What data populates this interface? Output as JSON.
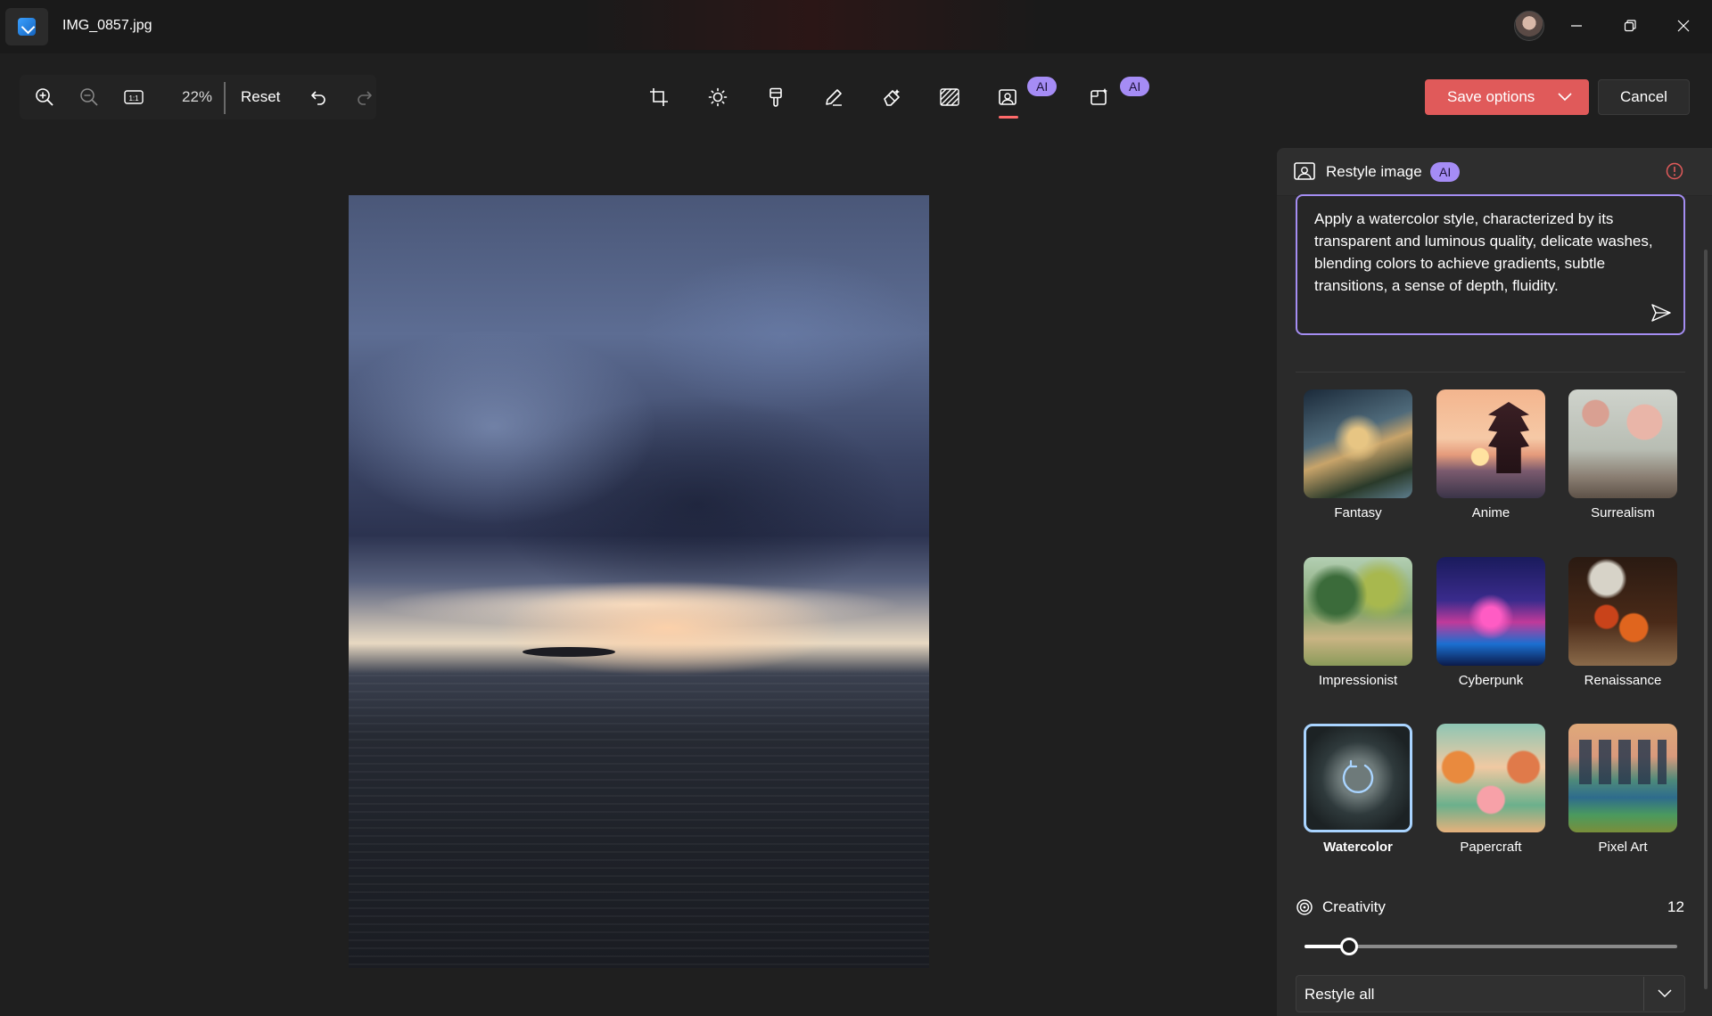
{
  "window": {
    "file_name": "IMG_0857.jpg",
    "controls": [
      "minimize-icon",
      "restore-icon",
      "close-icon"
    ]
  },
  "toolbar": {
    "zoom_level": "22%",
    "reset_label": "Reset",
    "icons": [
      "zoom-in-icon",
      "zoom-out-icon",
      "actual-size-icon",
      "undo-icon",
      "redo-icon"
    ]
  },
  "tools": [
    {
      "name": "crop",
      "icon": "crop-icon"
    },
    {
      "name": "adjust",
      "icon": "brightness-icon"
    },
    {
      "name": "filter",
      "icon": "filter-icon"
    },
    {
      "name": "markup",
      "icon": "pen-icon"
    },
    {
      "name": "erase",
      "icon": "eraser-icon"
    },
    {
      "name": "background",
      "icon": "background-icon"
    },
    {
      "name": "restyle",
      "icon": "restyle-icon",
      "active": true,
      "badge": "AI"
    },
    {
      "name": "generative",
      "icon": "generative-icon",
      "badge": "AI"
    }
  ],
  "actions": {
    "save_label": "Save options",
    "cancel_label": "Cancel"
  },
  "panel": {
    "title": "Restyle image",
    "badge": "AI",
    "prompt": "Apply a watercolor style, characterized by its transparent and luminous quality, delicate washes, blending colors to achieve gradients, subtle transitions, a sense of depth, fluidity.",
    "styles": [
      {
        "label": "Fantasy"
      },
      {
        "label": "Anime"
      },
      {
        "label": "Surrealism"
      },
      {
        "label": "Impressionist"
      },
      {
        "label": "Cyberpunk"
      },
      {
        "label": "Renaissance"
      },
      {
        "label": "Watercolor",
        "selected": true,
        "loading": true
      },
      {
        "label": "Papercraft"
      },
      {
        "label": "Pixel Art"
      }
    ],
    "creativity": {
      "label": "Creativity",
      "value": "12",
      "fraction": 0.12
    },
    "apply_mode": "Restyle all"
  },
  "colors": {
    "accent": "#e05a5a",
    "ai_badge": "#a58cf5",
    "prompt_border": "#a48df2",
    "selected_tile": "#a9d4ff",
    "active_tool_indicator": "#ff6a6a"
  }
}
